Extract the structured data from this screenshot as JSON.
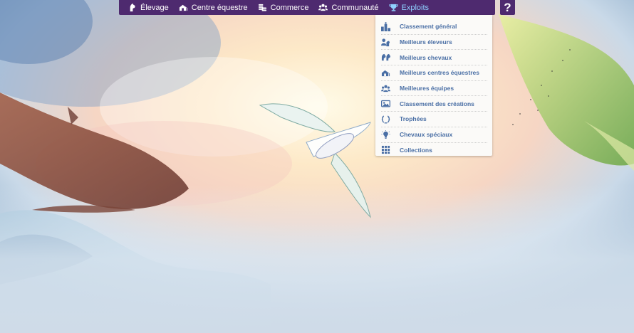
{
  "nav": {
    "items": [
      {
        "label": "Élevage",
        "icon": "horse-head-icon"
      },
      {
        "label": "Centre équestre",
        "icon": "stable-icon"
      },
      {
        "label": "Commerce",
        "icon": "coins-icon"
      },
      {
        "label": "Communauté",
        "icon": "people-icon"
      },
      {
        "label": "Exploits",
        "icon": "trophy-icon",
        "active": true
      }
    ],
    "help_label": "?"
  },
  "dropdown": {
    "items": [
      {
        "label": "Classement général",
        "icon": "podium-icon"
      },
      {
        "label": "Meilleurs éleveurs",
        "icon": "breeders-icon"
      },
      {
        "label": "Meilleurs chevaux",
        "icon": "horses-icon"
      },
      {
        "label": "Meilleurs centres équestres",
        "icon": "stable-icon"
      },
      {
        "label": "Meilleures équipes",
        "icon": "team-icon"
      },
      {
        "label": "Classement des créations",
        "icon": "creations-icon"
      },
      {
        "label": "Trophées",
        "icon": "laurel-icon"
      },
      {
        "label": "Chevaux spéciaux",
        "icon": "lightbulb-icon"
      },
      {
        "label": "Collections",
        "icon": "grid-icon"
      }
    ]
  },
  "colors": {
    "nav_bg": "#4e2a6f",
    "nav_text": "#ffffff",
    "active_text": "#8fd0ff",
    "dropdown_bg": "#fbfaf8",
    "dropdown_text": "#4a6fa5"
  }
}
